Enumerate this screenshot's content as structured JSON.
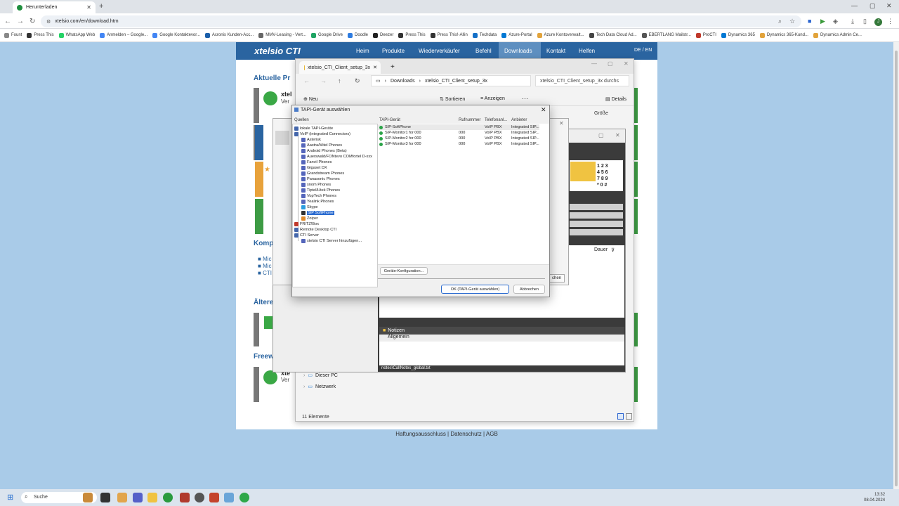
{
  "browser": {
    "tab_title": "Herunterladen",
    "url": "xtelsio.com/en/download.htm",
    "bookmarks": [
      "Fount",
      "Press This",
      "WhatsApp Web",
      "Anmelden – Google...",
      "Google Kontaktevor...",
      "Acronis Kunden-Acc...",
      "MMV-Leasing - Vert...",
      "Google Drive",
      "Doodle",
      "Deezer",
      "Press This",
      "Press This!-Allin",
      "Techdata",
      "Azure-Portal",
      "Azure Kontoverwalt...",
      "Tech Data Cloud Ad...",
      "EBERTLANG Mailstr...",
      "ProCTI",
      "Dynamics 365",
      "Dynamics 365-Kund...",
      "Dynamics Admin Ce..."
    ]
  },
  "site": {
    "logo": "xtelsio CTI",
    "nav": [
      "Heim",
      "Produkte",
      "Wiederverkäufer",
      "Befehl",
      "Downloads",
      "Kontakt",
      "Helfen"
    ],
    "lang": "DE / EN",
    "sections": [
      "Aktuelle Pr",
      "Komp",
      "Ältere",
      "Freew"
    ],
    "product_name_1": "xtel",
    "product_ver_1": "Ver",
    "product_name_2": "xte",
    "product_ver_2": "Ver",
    "bullets": [
      "Mic",
      "Mic",
      "CTI"
    ],
    "footer": "Haftungsausschluss | Datenschutz | AGB"
  },
  "explorer": {
    "tab_title": "xtelsio_CTI_Client_setup_3x",
    "path": [
      "Downloads",
      "xtelsio_CTI_Client_setup_3x"
    ],
    "search": "xtelsio_CTI_Client_setup_3x durchs",
    "toolbar": {
      "new": "Neu",
      "sort": "Sortieren",
      "view": "Anzeigen",
      "details": "Details"
    },
    "col_size": "Größe",
    "nav_items": [
      "Dieser PC",
      "Netzwerk"
    ],
    "status": "11 Elemente"
  },
  "cti": {
    "keys": [
      "1 2 3",
      "4 5 6",
      "7 8 9",
      "* 0 #"
    ],
    "call_cols": [
      "Dauer"
    ],
    "notes_title": "Notizen",
    "notes_tab": "Allgemein",
    "notes_path": "notes\\CallNotes_global.txt",
    "options_btn": "chen"
  },
  "dialog": {
    "title": "TAPI-Gerät auswählen",
    "sources_label": "Quellen",
    "tree": [
      {
        "label": "lokale TAPI-Geräte",
        "level": 0,
        "icon": "#4466aa"
      },
      {
        "label": "VoIP (integrated Connectors)",
        "level": 0,
        "icon": "#4466aa"
      },
      {
        "label": "Asterisk",
        "level": 1,
        "icon": "#5566bb"
      },
      {
        "label": "Aastra/Mitel Phones",
        "level": 1,
        "icon": "#5566bb"
      },
      {
        "label": "Android Phones (Beta)",
        "level": 1,
        "icon": "#5566bb"
      },
      {
        "label": "Auerswald/FONtevo COMfortel D-xxx",
        "level": 1,
        "icon": "#5566bb"
      },
      {
        "label": "Fanvil Phones",
        "level": 1,
        "icon": "#5566bb"
      },
      {
        "label": "Gigaset DX",
        "level": 1,
        "icon": "#5566bb"
      },
      {
        "label": "Grandstream Phones",
        "level": 1,
        "icon": "#5566bb"
      },
      {
        "label": "Panasonic Phones",
        "level": 1,
        "icon": "#5566bb"
      },
      {
        "label": "snom Phones",
        "level": 1,
        "icon": "#5566bb"
      },
      {
        "label": "Tiptel/Htek Phones",
        "level": 1,
        "icon": "#5566bb"
      },
      {
        "label": "VopTech Phones",
        "level": 1,
        "icon": "#5566bb"
      },
      {
        "label": "Yealink Phones",
        "level": 1,
        "icon": "#5566bb"
      },
      {
        "label": "Skype",
        "level": 1,
        "icon": "#2b9de0"
      },
      {
        "label": "SIP SoftPhone",
        "level": 1,
        "icon": "#333333",
        "selected": true
      },
      {
        "label": "Zoiper",
        "level": 1,
        "icon": "#e08a2b"
      },
      {
        "label": "FRITZ!Box",
        "level": 0,
        "icon": "#c0392b"
      },
      {
        "label": "Remote Desktop CTI",
        "level": 0,
        "icon": "#4466aa"
      },
      {
        "label": "CTI Server",
        "level": 0,
        "icon": "#4466aa"
      },
      {
        "label": "xtelsio CTI Server hinzufügen...",
        "level": 1,
        "icon": "#5566bb"
      }
    ],
    "columns": [
      "TAPI-Gerät",
      "Rufnummer",
      "Telefonanl...",
      "Anbieter"
    ],
    "devices": [
      {
        "name": "SIP-SoftPhone",
        "number": "",
        "pbx": "VoIP PBX",
        "vendor": "Integrated SIP..."
      },
      {
        "name": "SIP-Monitor1 for 000",
        "number": "000",
        "pbx": "VoIP PBX",
        "vendor": "Integrated SIP..."
      },
      {
        "name": "SIP-Monitor2 for 000",
        "number": "000",
        "pbx": "VoIP PBX",
        "vendor": "Integrated SIP..."
      },
      {
        "name": "SIP-Monitor3 for 000",
        "number": "000",
        "pbx": "VoIP PBX",
        "vendor": "Integrated SIP..."
      }
    ],
    "config_btn": "Geräte-Konfiguration...",
    "ok_btn": "OK  (TAPI-Gerät auswählen)",
    "cancel_btn": "Abbrechen"
  },
  "taskbar": {
    "search": "Suche",
    "time": "13:32",
    "date": "08.04.2024"
  }
}
